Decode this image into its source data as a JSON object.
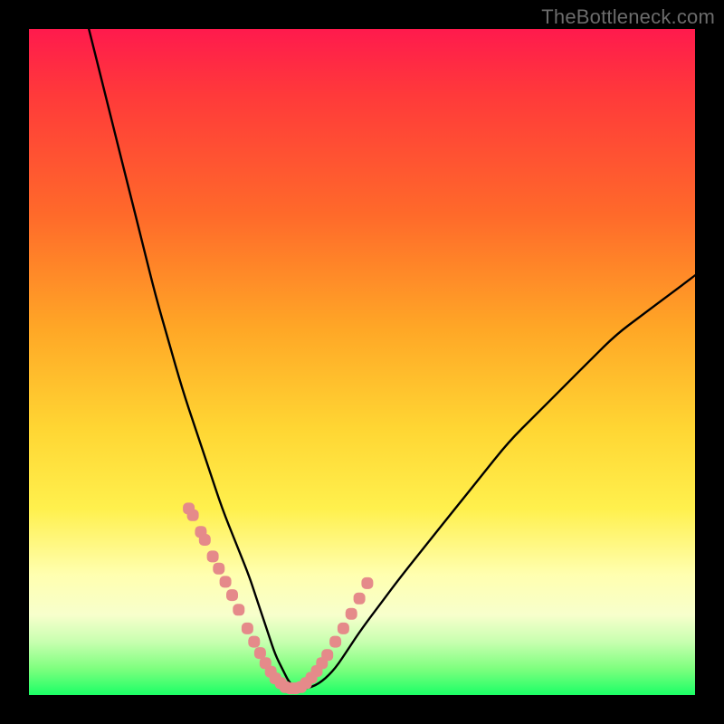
{
  "watermark": {
    "text": "TheBottleneck.com"
  },
  "colors": {
    "frame": "#000000",
    "curve_stroke": "#000000",
    "marker_fill": "#e58a8a",
    "marker_stroke": "#c96f6f",
    "gradient_stops": [
      "#ff1a4d",
      "#ff3a3a",
      "#ff6a2a",
      "#ffa726",
      "#ffd633",
      "#fff04d",
      "#ffffb0",
      "#f7ffcc",
      "#c8ffb0",
      "#7fff7f",
      "#1bff66"
    ]
  },
  "chart_data": {
    "type": "line",
    "title": "",
    "xlabel": "",
    "ylabel": "",
    "xlim": [
      0,
      100
    ],
    "ylim": [
      0,
      100
    ],
    "grid": false,
    "legend": false,
    "series": [
      {
        "name": "bottleneck-curve",
        "x": [
          9,
          11,
          13,
          15,
          17,
          19,
          21,
          23,
          25,
          27,
          29,
          31,
          33,
          34,
          35,
          36,
          37,
          38,
          39,
          40,
          42,
          44,
          46,
          48,
          50,
          53,
          56,
          60,
          64,
          68,
          72,
          76,
          80,
          84,
          88,
          92,
          96,
          100
        ],
        "y": [
          100,
          92,
          84,
          76,
          68,
          60,
          53,
          46,
          40,
          34,
          28,
          23,
          18,
          15,
          12,
          9,
          6,
          4,
          2,
          1,
          1,
          2,
          4,
          7,
          10,
          14,
          18,
          23,
          28,
          33,
          38,
          42,
          46,
          50,
          54,
          57,
          60,
          63
        ]
      }
    ],
    "markers": {
      "name": "highlight-dots",
      "x": [
        24.0,
        24.6,
        25.8,
        26.4,
        27.6,
        28.5,
        29.5,
        30.5,
        31.5,
        32.8,
        33.8,
        34.7,
        35.5,
        36.3,
        37.0,
        37.8,
        38.5,
        39.3,
        40.0,
        40.8,
        41.6,
        42.4,
        43.2,
        44.0,
        44.8,
        46.0,
        47.2,
        48.4,
        49.6,
        50.8
      ],
      "y": [
        28.0,
        27.0,
        24.5,
        23.3,
        20.8,
        19.0,
        17.0,
        15.0,
        12.8,
        10.0,
        8.0,
        6.3,
        4.8,
        3.5,
        2.5,
        1.8,
        1.2,
        1.0,
        1.0,
        1.2,
        1.8,
        2.6,
        3.6,
        4.8,
        6.0,
        8.0,
        10.0,
        12.2,
        14.5,
        16.8
      ]
    }
  }
}
